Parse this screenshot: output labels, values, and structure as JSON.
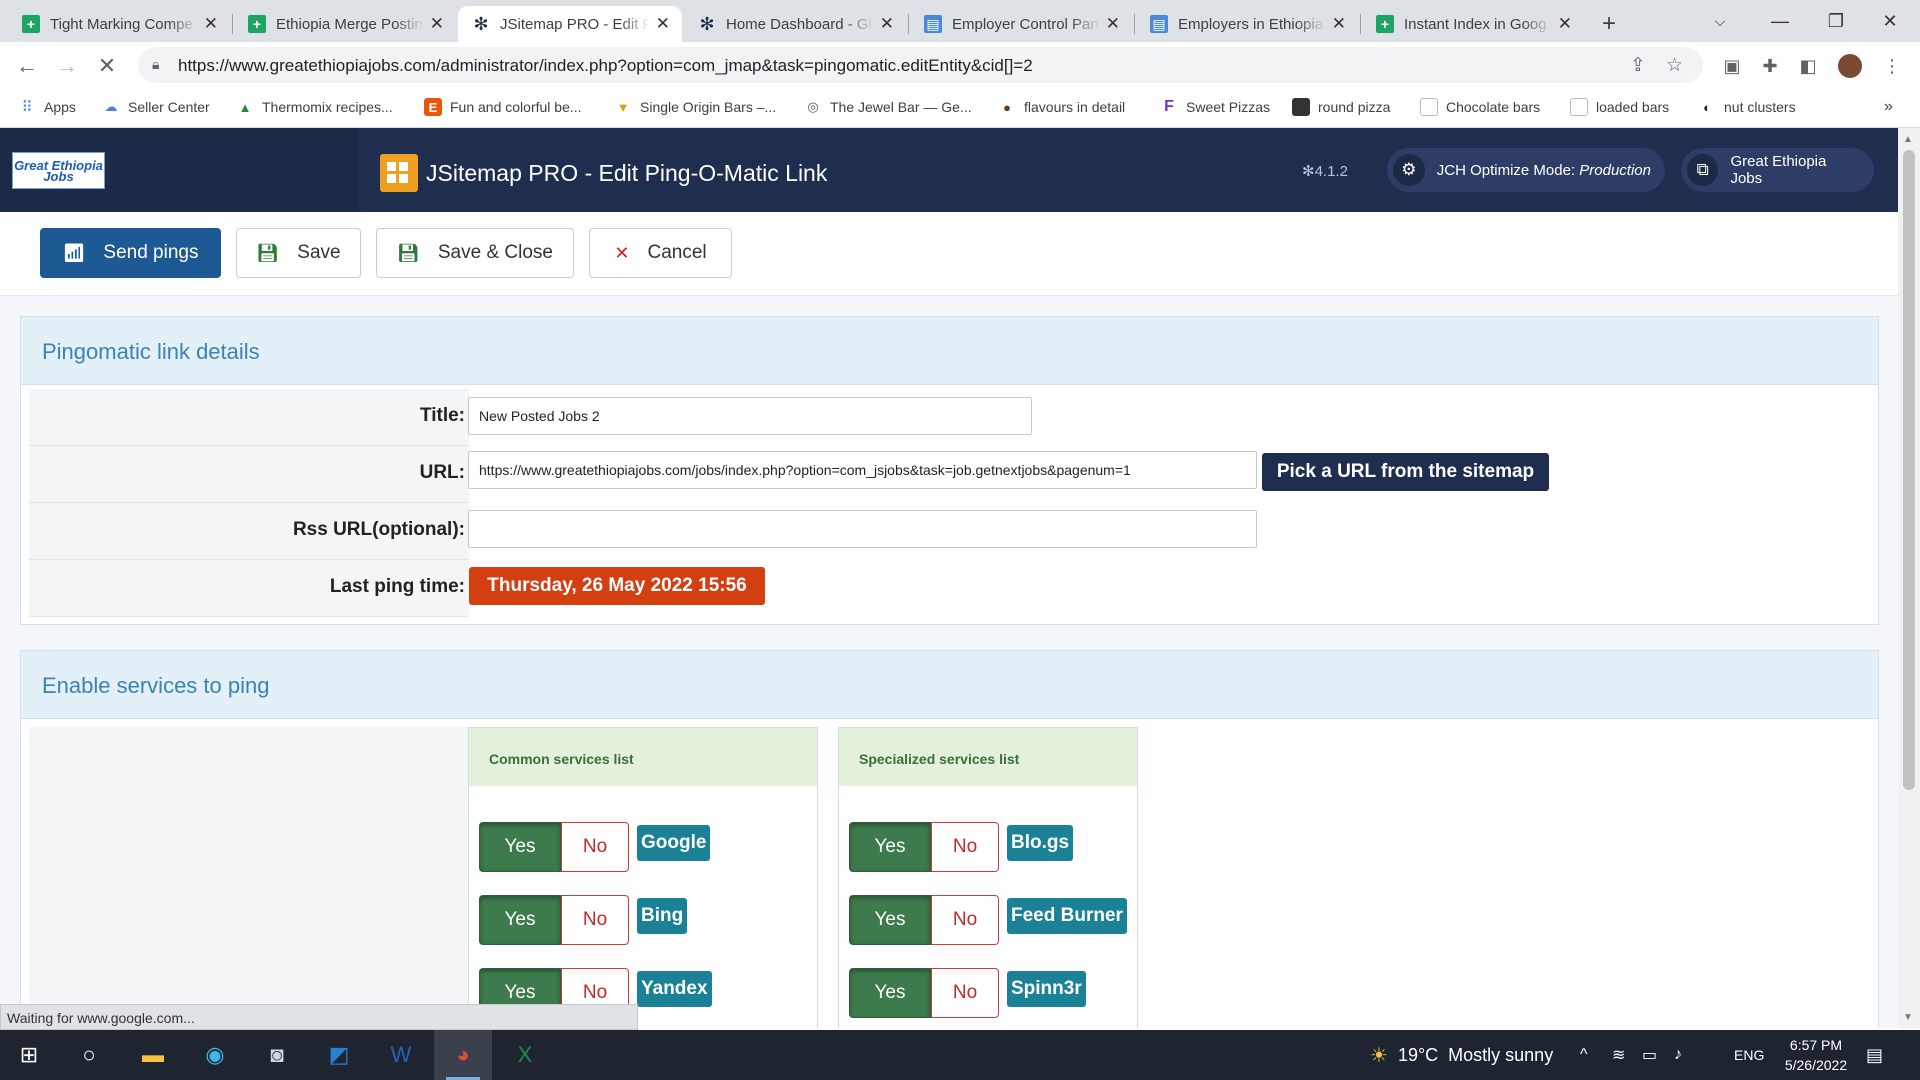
{
  "browser": {
    "tabs": [
      {
        "title": "Tight Marking Compe",
        "icon": "sheets-icon"
      },
      {
        "title": "Ethiopia Merge Postin",
        "icon": "sheets-icon"
      },
      {
        "title": "JSitemap PRO - Edit P",
        "icon": "joomla-icon"
      },
      {
        "title": "Home Dashboard - Gl",
        "icon": "joomla-icon"
      },
      {
        "title": "Employer Control Pan",
        "icon": "site-icon"
      },
      {
        "title": "Employers in Ethiopia",
        "icon": "site-icon"
      },
      {
        "title": "Instant Index in Goog",
        "icon": "sheets-icon"
      }
    ],
    "url": "https://www.greatethiopiajobs.com/administrator/index.php?option=com_jmap&task=pingomatic.editEntity&cid[]=2",
    "bookmarks": [
      {
        "label": "Apps"
      },
      {
        "label": "Seller Center"
      },
      {
        "label": "Thermomix recipes..."
      },
      {
        "label": "Fun and colorful be..."
      },
      {
        "label": "Single Origin Bars –..."
      },
      {
        "label": "The Jewel Bar — Ge..."
      },
      {
        "label": "flavours in detail"
      },
      {
        "label": "Sweet Pizzas"
      },
      {
        "label": "round pizza"
      },
      {
        "label": "Chocolate bars"
      },
      {
        "label": "loaded bars"
      },
      {
        "label": "nut clusters"
      }
    ],
    "bookmarks_overflow": "»"
  },
  "header": {
    "logo_text": "Great Ethiopia Jobs",
    "title": "JSitemap PRO - Edit Ping-O-Matic Link",
    "version": "4.1.2",
    "jch_prefix": "JCH Optimize Mode: ",
    "jch_mode": "Production",
    "site_link": "Great Ethiopia Jobs"
  },
  "toolbar": {
    "send_pings": "Send pings",
    "save": "Save",
    "save_close": "Save & Close",
    "cancel": "Cancel"
  },
  "details": {
    "heading": "Pingomatic link details",
    "title_label": "Title:",
    "title_value": "New Posted Jobs 2",
    "url_label": "URL:",
    "url_value": "https://www.greatethiopiajobs.com/jobs/index.php?option=com_jsjobs&task=job.getnextjobs&pagenum=1",
    "pick_url": "Pick a URL from the sitemap",
    "rss_label": "Rss URL(optional):",
    "rss_value": "",
    "last_ping_label": "Last ping time:",
    "last_ping_value": "Thursday, 26 May 2022 15:56"
  },
  "services": {
    "heading": "Enable services to ping",
    "yes": "Yes",
    "no": "No",
    "common": {
      "heading": "Common services list",
      "items": [
        "Google",
        "Bing",
        "Yandex"
      ]
    },
    "specialized": {
      "heading": "Specialized services list",
      "items": [
        "Blo.gs",
        "Feed Burner",
        "Spinn3r"
      ]
    }
  },
  "status_text": "Waiting for www.google.com...",
  "taskbar": {
    "weather": "19°C  Mostly sunny",
    "language": "ENG",
    "time": "6:57 PM",
    "date": "5/26/2022"
  },
  "colors": {
    "header_bg": "#1f2d4e",
    "primary_button": "#1d5a94",
    "date_badge": "#d43f12",
    "yes_green": "#3d7a4c",
    "service_label": "#1a8196"
  }
}
